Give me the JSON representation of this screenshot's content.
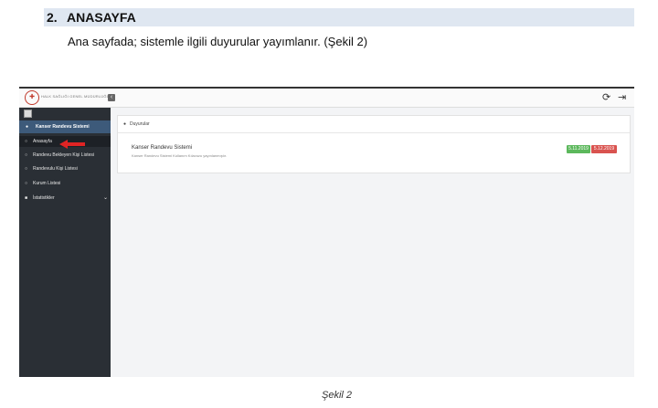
{
  "doc": {
    "heading_number": "2.",
    "heading_title": "ANASAYFA",
    "paragraph": "Ana sayfada; sistemle ilgili duyurular yayımlanır. (Şekil 2)",
    "caption": "Şekil 2"
  },
  "app": {
    "logo_text": "HALK SAĞLIĞI GENEL MÜDÜRLÜĞÜ",
    "sidebar": {
      "system_title": "Kanser Randevu Sistemi",
      "items": [
        {
          "label": "Anasayfa"
        },
        {
          "label": "Randevu Bekleyen Kişi Listesi"
        },
        {
          "label": "Randevulu Kişi Listesi"
        },
        {
          "label": "Kurum Listesi"
        },
        {
          "label": "İstatistikler"
        }
      ]
    },
    "panel": {
      "title": "Duyurular",
      "announcement": {
        "title": "Kanser Randevu Sistemi",
        "description": "Kanser Randevu Sistemi Kullanım Kılavuzu yayınlanmıştır.",
        "start_date": "5.11.2019",
        "end_date": "5.12.2019"
      }
    },
    "colors": {
      "sidebar_bg": "#2a2f35",
      "sidebar_header": "#3d5a7a",
      "badge_green": "#5cb85c",
      "badge_red": "#d9534f",
      "heading_bg": "#dfe7f1"
    }
  }
}
